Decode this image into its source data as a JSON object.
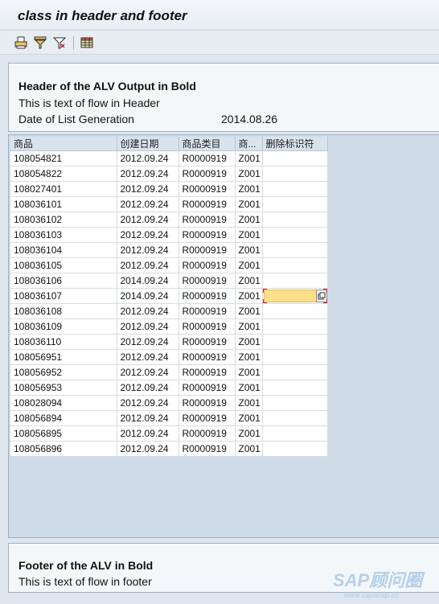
{
  "window": {
    "title": "class in header and footer"
  },
  "toolbar": {
    "buttons": [
      {
        "icon": "print-icon"
      },
      {
        "icon": "filter-icon"
      },
      {
        "icon": "filter-delete-icon"
      },
      {
        "icon": "layout-grid-icon"
      }
    ]
  },
  "header": {
    "title": "Header of the ALV Output in Bold",
    "text": "This is text of flow in Header",
    "date_label": "Date of List Generation",
    "date_value": "2014.08.26"
  },
  "grid": {
    "columns": [
      "商品",
      "创建日期",
      "商品类目",
      "商...",
      "删除标识符"
    ],
    "rows": [
      [
        "108054821",
        "2012.09.24",
        "R0000919",
        "Z001",
        ""
      ],
      [
        "108054822",
        "2012.09.24",
        "R0000919",
        "Z001",
        ""
      ],
      [
        "108027401",
        "2012.09.24",
        "R0000919",
        "Z001",
        ""
      ],
      [
        "108036101",
        "2012.09.24",
        "R0000919",
        "Z001",
        ""
      ],
      [
        "108036102",
        "2012.09.24",
        "R0000919",
        "Z001",
        ""
      ],
      [
        "108036103",
        "2012.09.24",
        "R0000919",
        "Z001",
        ""
      ],
      [
        "108036104",
        "2012.09.24",
        "R0000919",
        "Z001",
        ""
      ],
      [
        "108036105",
        "2012.09.24",
        "R0000919",
        "Z001",
        ""
      ],
      [
        "108036106",
        "2014.09.24",
        "R0000919",
        "Z001",
        ""
      ],
      [
        "108036107",
        "2014.09.24",
        "R0000919",
        "Z001",
        ""
      ],
      [
        "108036108",
        "2012.09.24",
        "R0000919",
        "Z001",
        ""
      ],
      [
        "108036109",
        "2012.09.24",
        "R0000919",
        "Z001",
        ""
      ],
      [
        "108036110",
        "2012.09.24",
        "R0000919",
        "Z001",
        ""
      ],
      [
        "108056951",
        "2012.09.24",
        "R0000919",
        "Z001",
        ""
      ],
      [
        "108056952",
        "2012.09.24",
        "R0000919",
        "Z001",
        ""
      ],
      [
        "108056953",
        "2012.09.24",
        "R0000919",
        "Z001",
        ""
      ],
      [
        "108028094",
        "2012.09.24",
        "R0000919",
        "Z001",
        ""
      ],
      [
        "108056894",
        "2012.09.24",
        "R0000919",
        "Z001",
        ""
      ],
      [
        "108056895",
        "2012.09.24",
        "R0000919",
        "Z001",
        ""
      ],
      [
        "108056896",
        "2012.09.24",
        "R0000919",
        "Z001",
        ""
      ]
    ],
    "active_row_index": 9,
    "active_column_index": 4
  },
  "footer": {
    "title": "Footer of the ALV in Bold",
    "text": "This is text of flow in footer"
  },
  "watermark": {
    "brand": "SAP顾问圈",
    "url": "www.sapabap.cn"
  },
  "colors": {
    "background": "#dfe6ef",
    "grid_background": "#cfdbe7",
    "active_cell": "#ffe08a",
    "focus_marker": "#cc2233"
  }
}
